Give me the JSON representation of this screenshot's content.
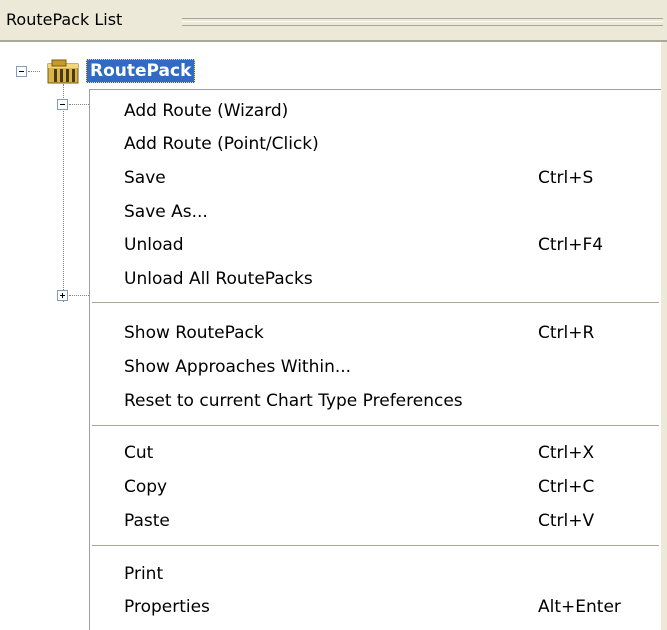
{
  "panel": {
    "title": "RoutePack List"
  },
  "tree": {
    "root_label": "RoutePack",
    "root_icon": "routepack-folder-icon",
    "expand_icon": "minus-expander-icon",
    "collapse_icon": "plus-expander-icon"
  },
  "menu": {
    "groups": [
      [
        {
          "label": "Add Route (Wizard)",
          "shortcut": ""
        },
        {
          "label": "Add Route (Point/Click)",
          "shortcut": ""
        },
        {
          "label": "Save",
          "shortcut": "Ctrl+S"
        },
        {
          "label": "Save As...",
          "shortcut": ""
        },
        {
          "label": "Unload",
          "shortcut": "Ctrl+F4"
        },
        {
          "label": "Unload All RoutePacks",
          "shortcut": ""
        }
      ],
      [
        {
          "label": "Show RoutePack",
          "shortcut": "Ctrl+R"
        },
        {
          "label": "Show Approaches Within...",
          "shortcut": ""
        },
        {
          "label": "Reset to current Chart Type Preferences",
          "shortcut": ""
        }
      ],
      [
        {
          "label": "Cut",
          "shortcut": "Ctrl+X"
        },
        {
          "label": "Copy",
          "shortcut": "Ctrl+C"
        },
        {
          "label": "Paste",
          "shortcut": "Ctrl+V"
        }
      ],
      [
        {
          "label": "Print",
          "shortcut": ""
        },
        {
          "label": "Properties",
          "shortcut": "Alt+Enter"
        }
      ]
    ]
  },
  "colors": {
    "selection": "#316ac5",
    "panel_bg": "#ece9d8",
    "separator": "#aca899"
  }
}
